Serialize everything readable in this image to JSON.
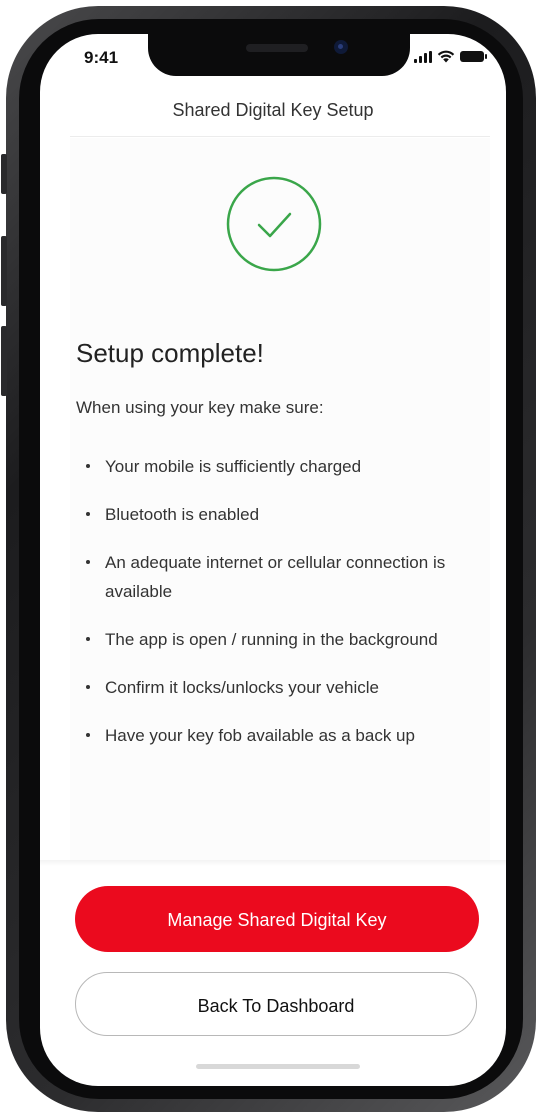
{
  "status_bar": {
    "time": "9:41"
  },
  "header": {
    "title": "Shared Digital Key Setup"
  },
  "success": {
    "icon": "check-circle-icon",
    "color": "#3aa64a"
  },
  "main": {
    "heading": "Setup complete!",
    "intro": "When using your key make sure:",
    "bullets": [
      "Your mobile is sufficiently charged",
      "Bluetooth is enabled",
      "An adequate internet or cellular connection is available",
      "The app is open / running in the background",
      "Confirm it locks/unlocks your vehicle",
      "Have your key fob available as a back up"
    ]
  },
  "actions": {
    "primary_label": "Manage Shared Digital Key",
    "secondary_label": "Back To Dashboard"
  },
  "colors": {
    "brand_red": "#eb0a1e"
  }
}
